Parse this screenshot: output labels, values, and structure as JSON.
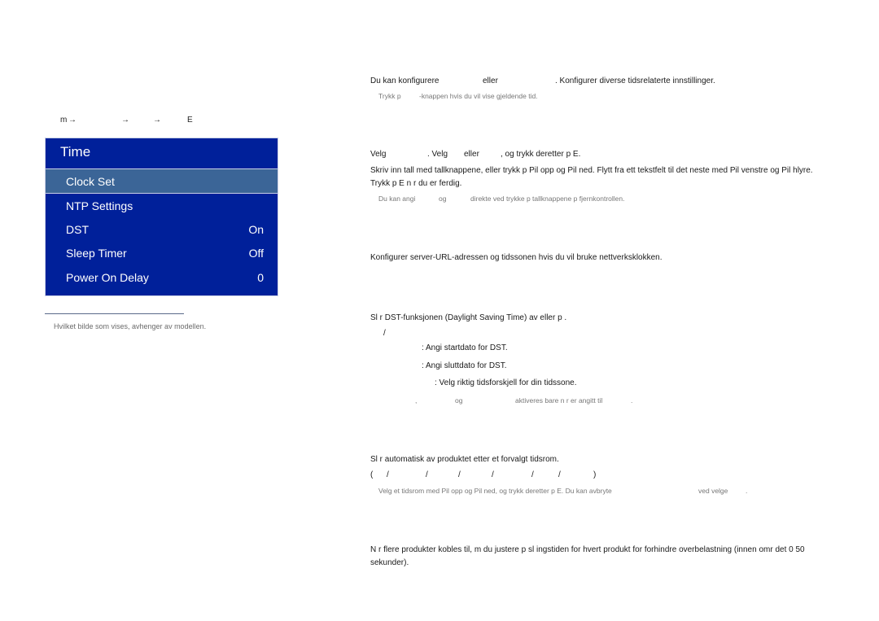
{
  "breadcrumb": {
    "segments": [
      "m",
      "→",
      "→",
      "→",
      "E"
    ]
  },
  "osd_menu": {
    "title": "Time",
    "items": [
      {
        "label": "Clock Set",
        "value": "",
        "selected": true
      },
      {
        "label": "NTP Settings",
        "value": "",
        "selected": false
      },
      {
        "label": "DST",
        "value": "On",
        "selected": false
      },
      {
        "label": "Sleep Timer",
        "value": "Off",
        "selected": false
      },
      {
        "label": "Power On Delay",
        "value": "0",
        "selected": false
      }
    ],
    "colors": {
      "background": "#00209a",
      "selected": "#3b6597",
      "text": "#ffffff"
    }
  },
  "footnote": "Hvilket bilde som vises, avhenger av modellen.",
  "intro": {
    "line": {
      "part1": "Du kan konfigurere",
      "part2": "eller",
      "part3": ". Konfigurer diverse tidsrelaterte innstillinger."
    },
    "note": {
      "part1": "Trykk p",
      "part2": "-knappen hvis du vil vise gjeldende tid."
    }
  },
  "clock_set": {
    "line1": {
      "part1": "Velg",
      "part2": ". Velg",
      "part3": "eller",
      "part4": ", og trykk deretter p   E."
    },
    "line2": "Skriv inn tall med tallknappene, eller trykk p  Pil opp og Pil ned. Flytt fra ett tekstfelt til det neste med Pil venstre og Pil høyre.",
    "line2_display": "Skriv inn tall med tallknappene, eller trykk p  Pil opp og Pil ned. Flytt fra ett tekstfelt til det neste med Pil venstre og Pil hlyre.",
    "line3": "Trykk p   E n r du er ferdig.",
    "note": {
      "part1": "Du kan angi",
      "part2": "og",
      "part3": "direkte ved   trykke p  tallknappene p  fjernkontrollen."
    }
  },
  "ntp": {
    "line": "Konfigurer server-URL-adressen og tidssonen hvis du vil bruke nettverksklokken."
  },
  "dst": {
    "line": "Sl r DST-funksjonen (Daylight Saving Time) av eller p .",
    "options_slash": "/",
    "start": ": Angi startdato for DST.",
    "end": ": Angi sluttdato for DST.",
    "offset": ": Velg riktig tidsforskjell for din tidssone.",
    "note": {
      "comma": ",",
      "og": "og",
      "rest": "aktiveres bare n r    er angitt til",
      "dot": "."
    }
  },
  "sleep_timer": {
    "line": "Sl r automatisk av produktet etter et forvalgt tidsrom.",
    "options": [
      "(",
      "/",
      "/",
      "/",
      "/",
      "/",
      "/",
      ")"
    ],
    "note": {
      "part1": "Velg et tidsrom med Pil opp og Pil ned, og trykk deretter p   E. Du kan avbryte",
      "part2": "ved   velge",
      "part3": "."
    }
  },
  "power_on_delay": {
    "line1": "N r flere produkter kobles til, m  du justere p  sl ingstiden for hvert produkt for   forhindre overbelastning (innen omr det 0 50",
    "line2": "sekunder)."
  }
}
